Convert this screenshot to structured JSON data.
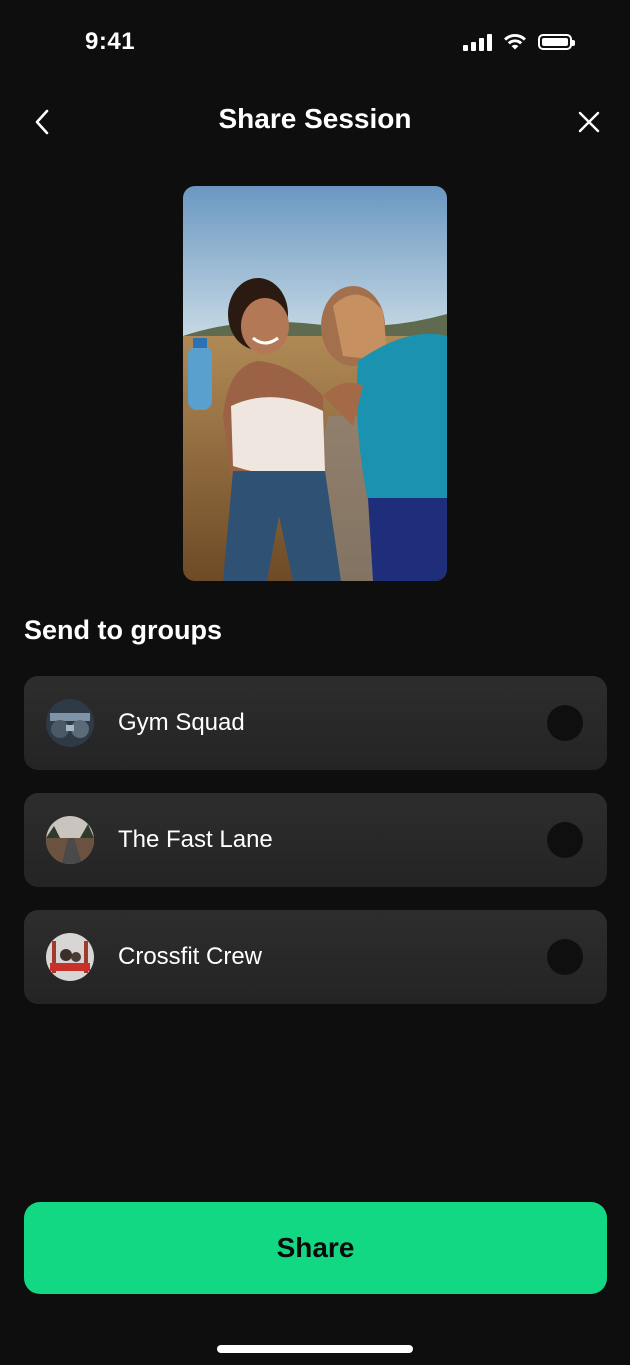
{
  "status_bar": {
    "time": "9:41",
    "icons": [
      "signal-icon",
      "wifi-icon",
      "battery-icon"
    ]
  },
  "header": {
    "title": "Share Session",
    "back_icon": "chevron-left-icon",
    "close_icon": "close-icon"
  },
  "section": {
    "title": "Send to groups"
  },
  "groups": [
    {
      "name": "Gym Squad",
      "avatar": "gym-avatar",
      "selected": false
    },
    {
      "name": "The Fast Lane",
      "avatar": "road-avatar",
      "selected": false
    },
    {
      "name": "Crossfit Crew",
      "avatar": "crossfit-avatar",
      "selected": false
    }
  ],
  "share_button": {
    "label": "Share"
  },
  "colors": {
    "background": "#0e0e0e",
    "card": "#2a2a2a",
    "accent": "#12d883"
  }
}
